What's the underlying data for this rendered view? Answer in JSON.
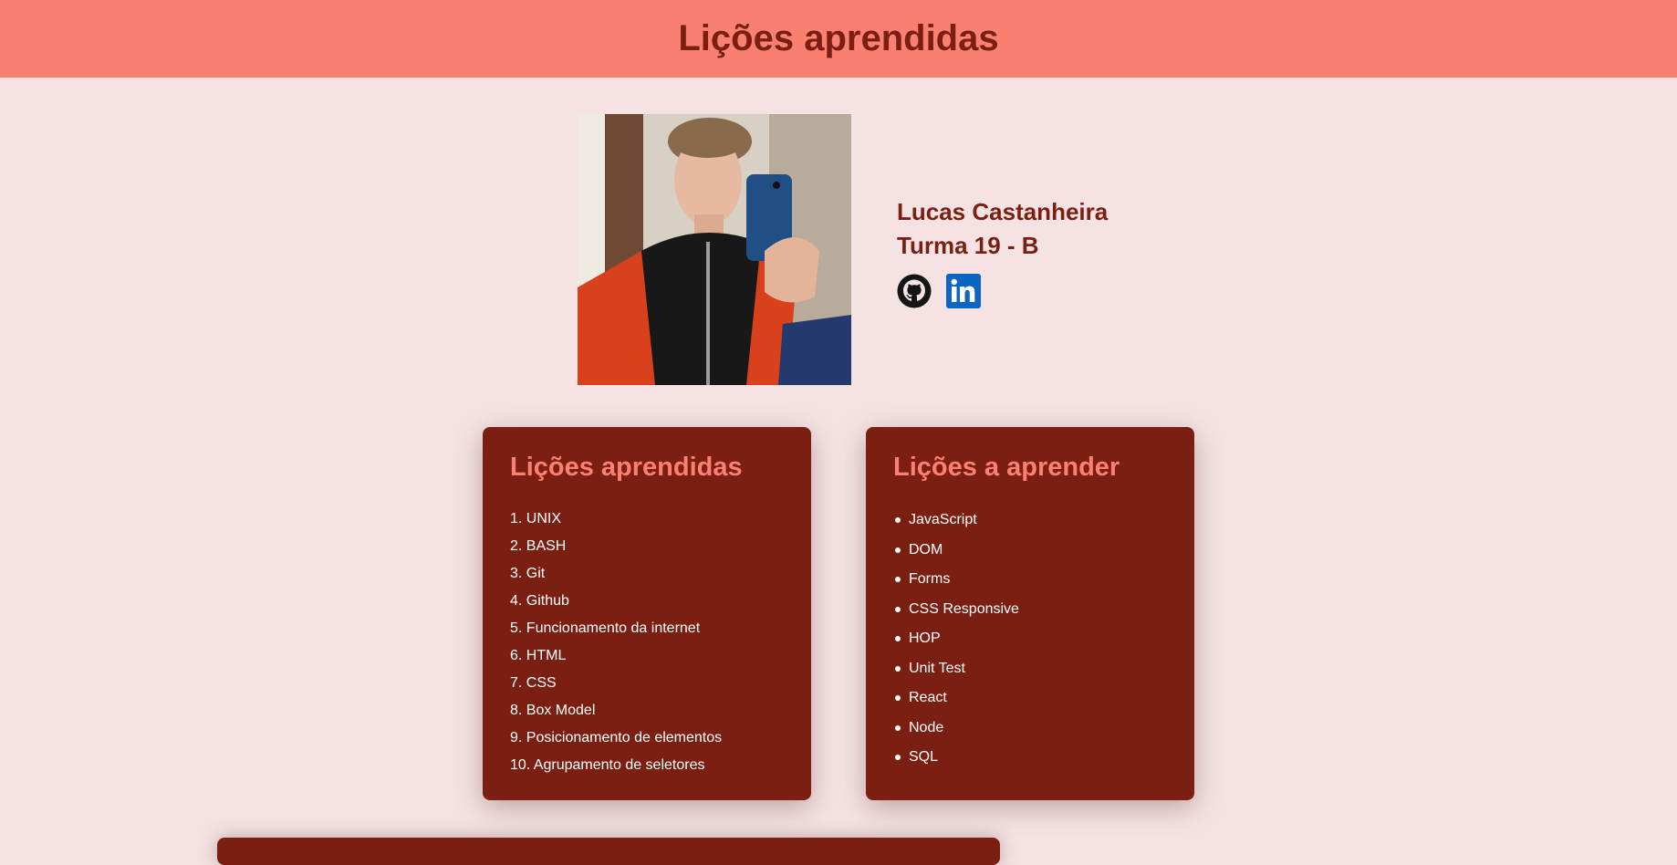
{
  "header": {
    "title": "Lições aprendidas"
  },
  "profile": {
    "name": "Lucas Castanheira",
    "class": "Turma 19 - B",
    "photo_alt": "",
    "social": [
      {
        "icon": "github-icon"
      },
      {
        "icon": "linkedin-icon"
      }
    ]
  },
  "learned": {
    "title": "Lições aprendidas",
    "items": [
      "1. UNIX",
      "2. BASH",
      "3. Git",
      "4. Github",
      "5. Funcionamento da internet",
      "6. HTML",
      "7. CSS",
      "8. Box Model",
      "9. Posicionamento de elementos",
      "10. Agrupamento de seletores"
    ]
  },
  "to_learn": {
    "title": "Lições a aprender",
    "items": [
      "JavaScript",
      "DOM",
      "Forms",
      "CSS Responsive",
      "HOP",
      "Unit Test",
      "React",
      "Node",
      "SQL"
    ]
  },
  "colors": {
    "header_bg": "#fa8072",
    "page_bg": "#f5e3e4",
    "accent_dark": "#7b1f13",
    "linkedin_blue": "#0a66c2"
  }
}
